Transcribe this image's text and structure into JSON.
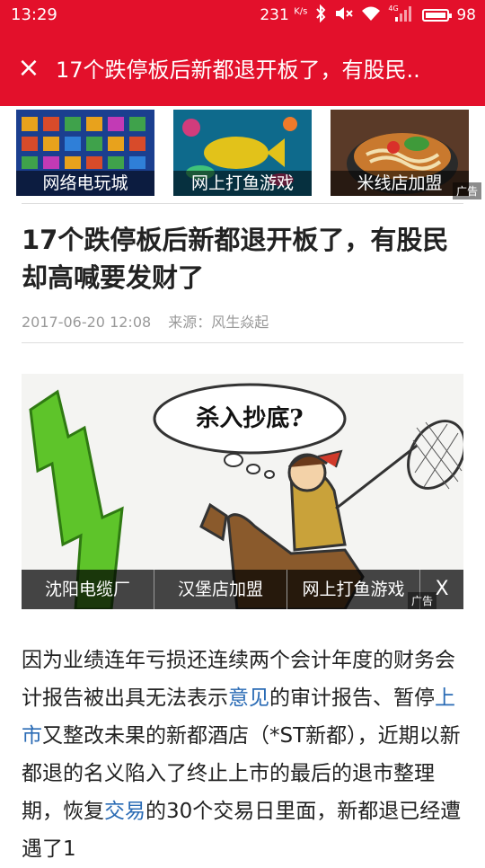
{
  "status": {
    "time": "13:29",
    "speed_value": "231",
    "speed_unit": "K/s",
    "network": "4G",
    "battery": "98",
    "battery_level": 0.98,
    "icons": [
      "bluetooth-icon",
      "mute-icon",
      "wifi-icon",
      "signal-icon",
      "battery-icon"
    ]
  },
  "header": {
    "close_glyph": "×",
    "title": "17个跌停板后新都退开板了，有股民..",
    "color": "#e3102b"
  },
  "ads_top": [
    {
      "caption": "网络电玩城"
    },
    {
      "caption": "网上打鱼游戏"
    },
    {
      "caption": "米线店加盟"
    }
  ],
  "ad_tag": "广告",
  "article": {
    "headline": "17个跌停板后新都退开板了，有股民却高喊要发财了",
    "date": "2017-06-20 12:08",
    "source": "来源：风生焱起",
    "image_bubble": "杀入抄底?",
    "image_ads": [
      "沈阳电缆厂",
      "汉堡店加盟",
      "网上打鱼游戏"
    ],
    "image_ad_close": "X",
    "body": {
      "p1": "因为业绩连年亏损还连续两个会计年度的财务会计报告被出具无法表示",
      "link1": "意见",
      "p2": "的审计报告、暂停",
      "link2": "上市",
      "p3": "又整改未果的新都酒店（*ST新都），近期以新都退的名义陷入了终止上市的最后的退市整理期，恢复",
      "link3": "交易",
      "p4": "的30个交易日里面，新都退已经遭遇了1",
      "link_color": "#2a6bb5"
    }
  }
}
